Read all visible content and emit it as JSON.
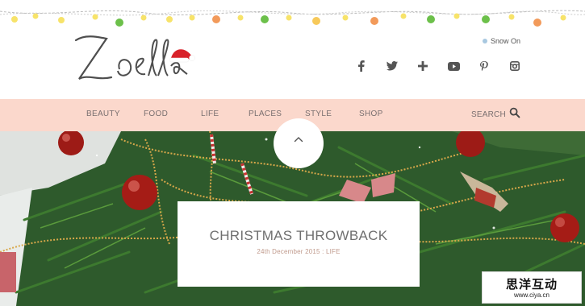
{
  "brand": {
    "logo_text": "Zoella"
  },
  "header": {
    "snow_toggle_label": "Snow On"
  },
  "social": [
    "facebook-icon",
    "twitter-icon",
    "plus-icon",
    "youtube-icon",
    "pinterest-icon",
    "instagram-icon"
  ],
  "nav": {
    "items": [
      {
        "label": "BEAUTY"
      },
      {
        "label": "FOOD"
      },
      {
        "label": "LIFE"
      },
      {
        "label": "PLACES"
      },
      {
        "label": "STYLE"
      },
      {
        "label": "SHOP"
      }
    ],
    "search_label": "SEARCH"
  },
  "post": {
    "title": "CHRISTMAS THROWBACK",
    "meta": "24th December 2015 : LIFE"
  },
  "watermark": {
    "chinese": "思洋互动",
    "url": "www.ciya.cn"
  },
  "colors": {
    "nav_background": "#fbd8cc",
    "text_grey": "#6f6f6f",
    "meta_accent": "#c09a8c",
    "santa_hat": "#d8222a",
    "tree_green": "#2f5a2c"
  }
}
